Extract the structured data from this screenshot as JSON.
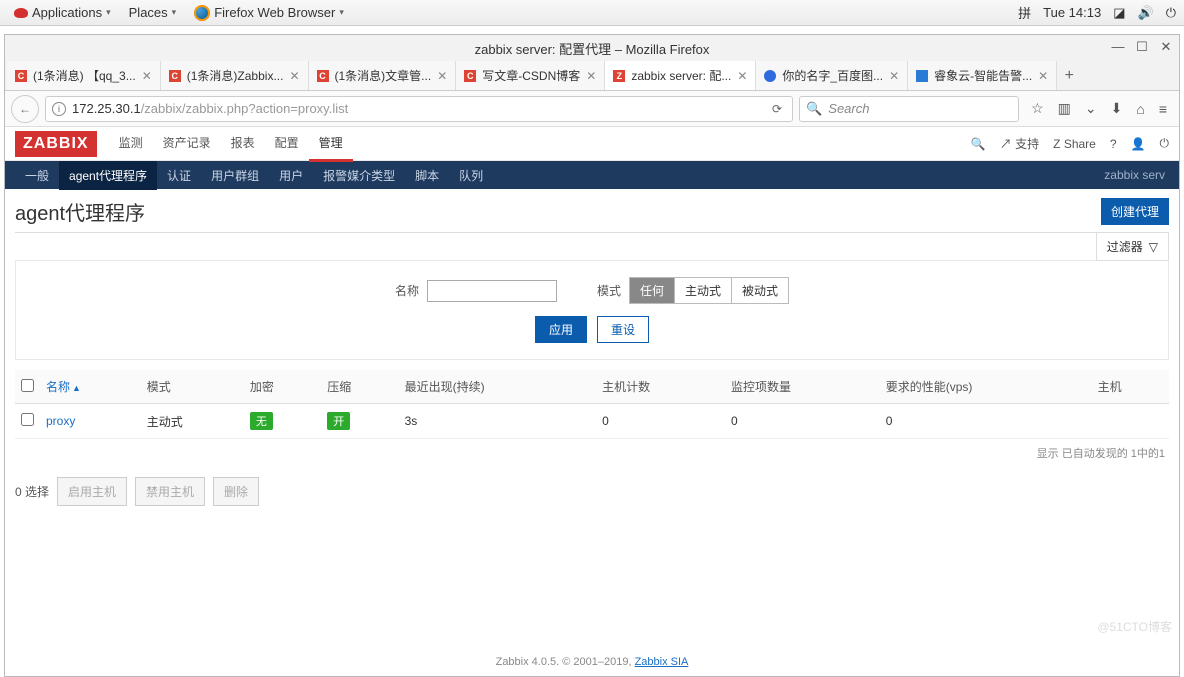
{
  "gnome": {
    "applications": "Applications",
    "places": "Places",
    "browser": "Firefox Web Browser",
    "ime": "拼",
    "clock": "Tue 14:13"
  },
  "firefox": {
    "title": "zabbix server: 配置代理 – Mozilla Firefox",
    "tabs": [
      {
        "label": "(1条消息) 【qq_3..."
      },
      {
        "label": "(1条消息)Zabbix..."
      },
      {
        "label": "(1条消息)文章管..."
      },
      {
        "label": "写文章-CSDN博客"
      },
      {
        "label": "zabbix server: 配..."
      },
      {
        "label": "你的名字_百度图..."
      },
      {
        "label": "睿象云-智能告警..."
      }
    ],
    "url_host": "172.25.30.1",
    "url_path": "/zabbix/zabbix.php",
    "url_query": "?action=proxy.list",
    "search_placeholder": "Search"
  },
  "zabbix": {
    "logo": "ZABBIX",
    "menu": [
      "监测",
      "资产记录",
      "报表",
      "配置",
      "管理"
    ],
    "menu_active": 4,
    "support": "支持",
    "share": "Share",
    "submenu": [
      "一般",
      "agent代理程序",
      "认证",
      "用户群组",
      "用户",
      "报警媒介类型",
      "脚本",
      "队列"
    ],
    "submenu_active": 1,
    "submenu_right": "zabbix serv",
    "page_title": "agent代理程序",
    "btn_create": "创建代理",
    "filter_tab": "过滤器",
    "filter": {
      "name_label": "名称",
      "name_value": "",
      "mode_label": "模式",
      "mode_options": [
        "任何",
        "主动式",
        "被动式"
      ],
      "apply": "应用",
      "reset": "重设"
    },
    "table": {
      "headers": {
        "name": "名称",
        "mode": "模式",
        "encryption": "加密",
        "compression": "压缩",
        "last_seen": "最近出现(持续)",
        "host_count": "主机计数",
        "item_count": "监控项数量",
        "required_perf": "要求的性能(vps)",
        "host": "主机"
      },
      "rows": [
        {
          "name": "proxy",
          "mode": "主动式",
          "encryption": "无",
          "compression": "开",
          "last_seen": "3s",
          "host_count": "0",
          "item_count": "0",
          "required_perf": "0",
          "host": ""
        }
      ],
      "footer_info": "显示 已自动发现的 1中的1"
    },
    "bulk": {
      "selected_label": "0 选择",
      "enable": "启用主机",
      "disable": "禁用主机",
      "delete": "删除"
    },
    "footer": {
      "text": "Zabbix 4.0.5. © 2001–2019, ",
      "link": "Zabbix SIA"
    }
  },
  "watermark": "@51CTO博客"
}
